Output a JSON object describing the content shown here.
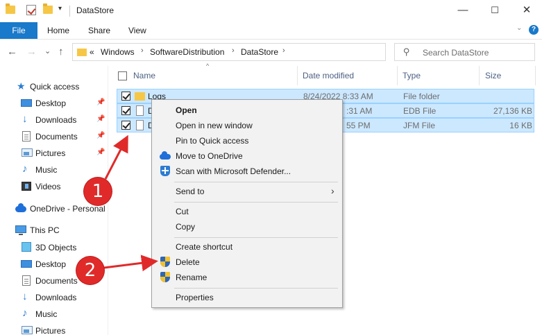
{
  "window": {
    "title": "DataStore",
    "minimize": "—",
    "maximize": "☐",
    "close": "✕"
  },
  "quick_toolbar": {
    "customize_glyph": "▾"
  },
  "ribbon": {
    "tabs": [
      "File",
      "Home",
      "Share",
      "View"
    ],
    "collapse_glyph": "⌄",
    "help_glyph": "?"
  },
  "nav": {
    "back": "←",
    "forward": "→",
    "recent": "⌄",
    "up": "↑",
    "refresh": "↻"
  },
  "address": {
    "overflow": "«",
    "crumbs": [
      "Windows",
      "SoftwareDistribution",
      "DataStore"
    ],
    "separator": "›",
    "dropdown": "⌄"
  },
  "search": {
    "icon": "⚲",
    "placeholder": "Search DataStore"
  },
  "navpane": {
    "quick_access": "Quick access",
    "quick_items": [
      "Desktop",
      "Downloads",
      "Documents",
      "Pictures",
      "Music",
      "Videos"
    ],
    "pin_glyph": "📌",
    "onedrive": "OneDrive - Personal",
    "this_pc": "This PC",
    "pc_items": [
      "3D Objects",
      "Desktop",
      "Documents",
      "Downloads",
      "Music",
      "Pictures"
    ]
  },
  "columns": {
    "sort_glyph": "^",
    "name": "Name",
    "date": "Date modified",
    "type": "Type",
    "size": "Size"
  },
  "files": [
    {
      "name": "Logs",
      "date": "8/24/2022 8:33 AM",
      "type": "File folder",
      "size": ""
    },
    {
      "name": "D",
      "date": ":31 AM",
      "type": "EDB File",
      "size": "27,136 KB"
    },
    {
      "name": "D",
      "date": "55 PM",
      "type": "JFM File",
      "size": "16 KB"
    }
  ],
  "context_menu": {
    "open": "Open",
    "open_new_window": "Open in new window",
    "pin_quick_access": "Pin to Quick access",
    "move_onedrive": "Move to OneDrive",
    "scan_defender": "Scan with Microsoft Defender...",
    "send_to": "Send to",
    "submenu_glyph": "›",
    "cut": "Cut",
    "copy": "Copy",
    "create_shortcut": "Create shortcut",
    "delete": "Delete",
    "rename": "Rename",
    "properties": "Properties"
  },
  "annotations": {
    "step1": "1",
    "step2": "2",
    "color": "#e02a2a"
  }
}
